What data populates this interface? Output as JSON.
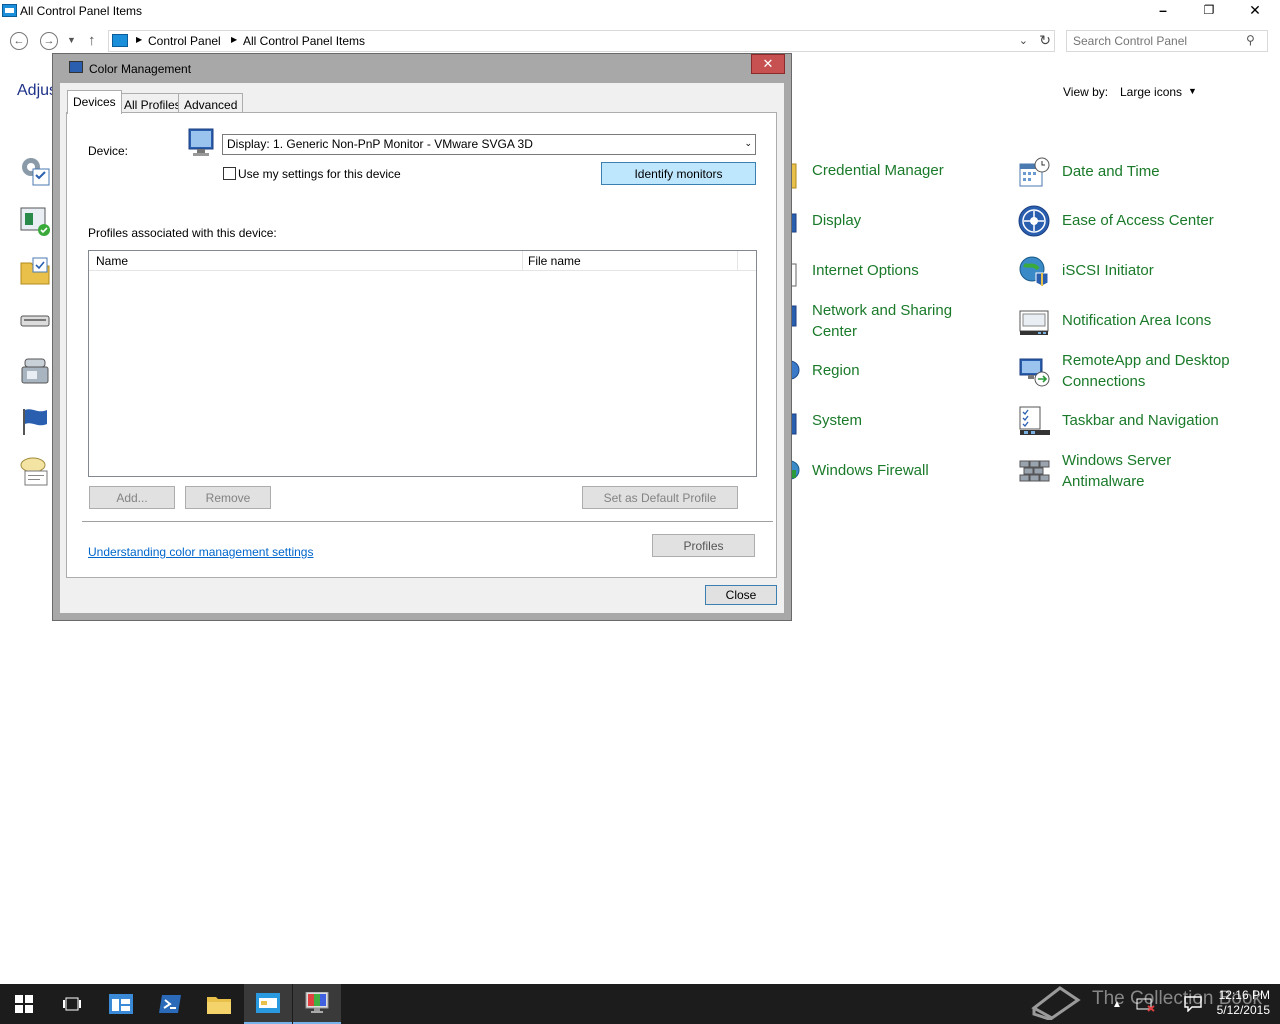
{
  "window": {
    "title": "All Control Panel Items",
    "controls": {
      "minimize": "–",
      "maximize": "❐",
      "close": "✕"
    }
  },
  "address": {
    "crumbs": [
      "Control Panel",
      "All Control Panel Items"
    ],
    "search_placeholder": "Search Control Panel"
  },
  "page": {
    "heading_partial": "Adjus",
    "view_by_label": "View by:",
    "view_by_value": "Large icons"
  },
  "cp_items": [
    {
      "label": "Credential Manager",
      "icon": "credential-manager-icon"
    },
    {
      "label": "Display",
      "icon": "display-icon"
    },
    {
      "label": "Internet Options",
      "icon": "internet-options-icon"
    },
    {
      "label": "Network and Sharing Center",
      "icon": "network-sharing-icon"
    },
    {
      "label": "Region",
      "icon": "region-icon"
    },
    {
      "label": "System",
      "icon": "system-icon"
    },
    {
      "label": "Windows Firewall",
      "icon": "windows-firewall-icon"
    },
    {
      "label": "Date and Time",
      "icon": "date-time-icon"
    },
    {
      "label": "Ease of Access Center",
      "icon": "ease-of-access-icon"
    },
    {
      "label": "iSCSI Initiator",
      "icon": "iscsi-initiator-icon"
    },
    {
      "label": "Notification Area Icons",
      "icon": "notification-area-icon"
    },
    {
      "label": "RemoteApp and Desktop Connections",
      "icon": "remoteapp-icon"
    },
    {
      "label": "Taskbar and Navigation",
      "icon": "taskbar-navigation-icon"
    },
    {
      "label": "Windows Server Antimalware",
      "icon": "antimalware-icon"
    }
  ],
  "dialog": {
    "title": "Color Management",
    "close_glyph": "✕",
    "tabs": [
      "Devices",
      "All Profiles",
      "Advanced"
    ],
    "active_tab": "Devices",
    "device_label": "Device:",
    "device_value": "Display: 1. Generic Non-PnP Monitor - VMware SVGA 3D",
    "use_my_settings": "Use my settings for this device",
    "use_my_settings_checked": false,
    "identify_button": "Identify monitors",
    "profiles_label": "Profiles associated with this device:",
    "columns": [
      "Name",
      "File name"
    ],
    "add_button": "Add...",
    "remove_button": "Remove",
    "set_default_button": "Set as Default Profile",
    "link": "Understanding color management settings",
    "profiles_button": "Profiles",
    "close_button": "Close"
  },
  "taskbar": {
    "time": "12:16 PM",
    "date": "5/12/2015",
    "watermark": "The Collection Book"
  },
  "colors": {
    "link_green": "#1a7a2a",
    "identify_bg": "#bee6fd",
    "dialog_close": "#c75050",
    "taskbar": "#1c1c1c"
  }
}
